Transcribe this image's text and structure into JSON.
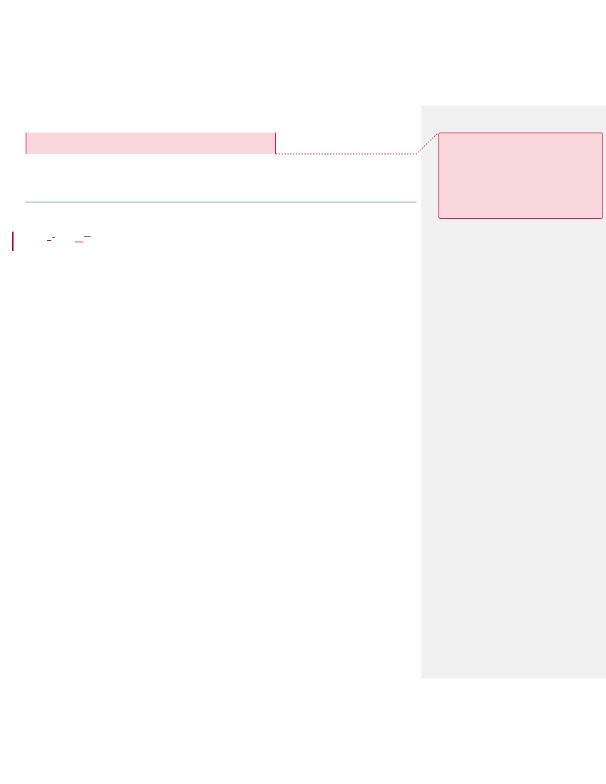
{
  "document": {
    "highlighted_text": "",
    "fragments": [
      "",
      ""
    ]
  },
  "comment": {
    "text": ""
  },
  "colors": {
    "page_background": "#ffffff",
    "markup_pane": "#f1f1f1",
    "comment_fill": "#fad6dd",
    "markup_accent": "#c4184a",
    "change_bar": "#b3002d",
    "rule_line": "#5b84b8"
  }
}
